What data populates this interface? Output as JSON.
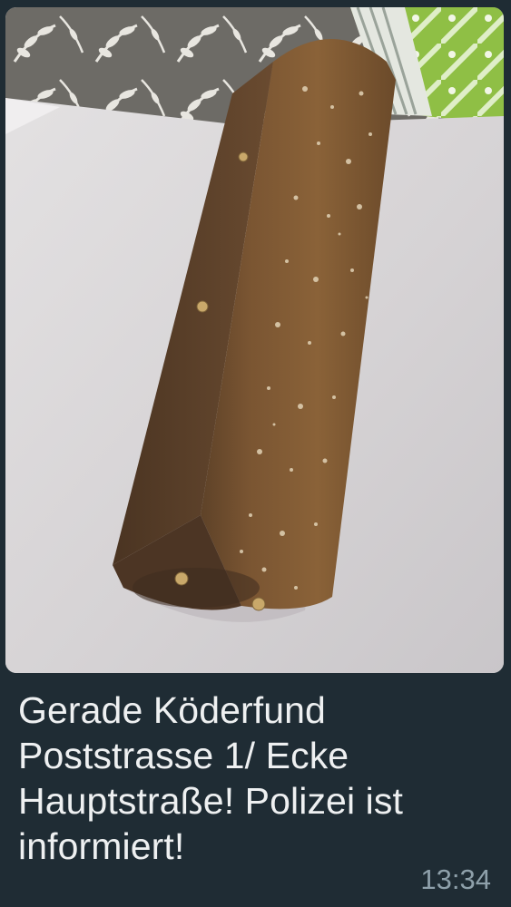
{
  "message": {
    "caption_lines": [
      "Gerade Köderfund",
      "Poststrasse 1/ Ecke",
      "Hauptstraße! Polizei ist",
      "informiert!"
    ],
    "timestamp": "13:34"
  },
  "photo": {
    "subject": "bait-bar-with-nails"
  },
  "colors": {
    "bubble_background": "#1f2c34",
    "caption_text": "#eef0f1",
    "timestamp_text": "#8ea0aa"
  }
}
